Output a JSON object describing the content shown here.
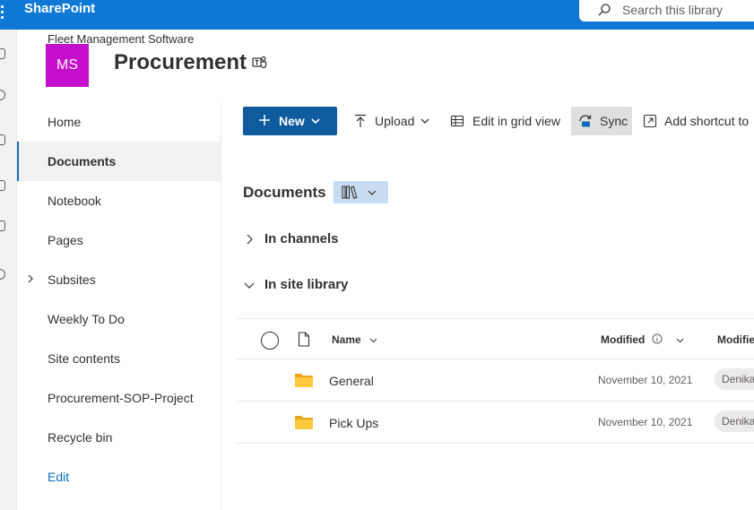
{
  "suite_bar": {
    "brand": "SharePoint",
    "search_placeholder": "Search this library",
    "color": "#0f78d4"
  },
  "site": {
    "parent": "Fleet Management Software",
    "logo_initials": "MS",
    "logo_color": "#c50ecb",
    "title": "Procurement"
  },
  "nav": {
    "items": [
      {
        "label": "Home"
      },
      {
        "label": "Documents",
        "selected": true
      },
      {
        "label": "Notebook"
      },
      {
        "label": "Pages"
      },
      {
        "label": "Subsites",
        "expandable": true
      },
      {
        "label": "Weekly To Do"
      },
      {
        "label": "Site contents"
      },
      {
        "label": "Procurement-SOP-Project"
      },
      {
        "label": "Recycle bin"
      },
      {
        "label": "Edit"
      }
    ]
  },
  "commands": {
    "new": "New",
    "upload": "Upload",
    "grid_view": "Edit in grid view",
    "sync": "Sync",
    "add_shortcut": "Add shortcut to"
  },
  "library": {
    "title": "Documents",
    "groups": [
      {
        "label": "In channels",
        "expanded": false
      },
      {
        "label": "In site library",
        "expanded": true
      }
    ],
    "columns": {
      "name": "Name",
      "modified": "Modified",
      "modified_by": "Modifie"
    },
    "rows": [
      {
        "name": "General",
        "modified": "November 10, 2021",
        "modified_by": "Denika"
      },
      {
        "name": "Pick Ups",
        "modified": "November 10, 2021",
        "modified_by": "Denika"
      }
    ]
  },
  "icons": [
    "waffle-icon",
    "search-icon",
    "teams-icon",
    "plus-icon",
    "upload-icon",
    "grid-icon",
    "sync-icon",
    "shortcut-icon",
    "library-view-icon",
    "chevron-icon",
    "folder-icon",
    "document-icon",
    "info-icon"
  ]
}
